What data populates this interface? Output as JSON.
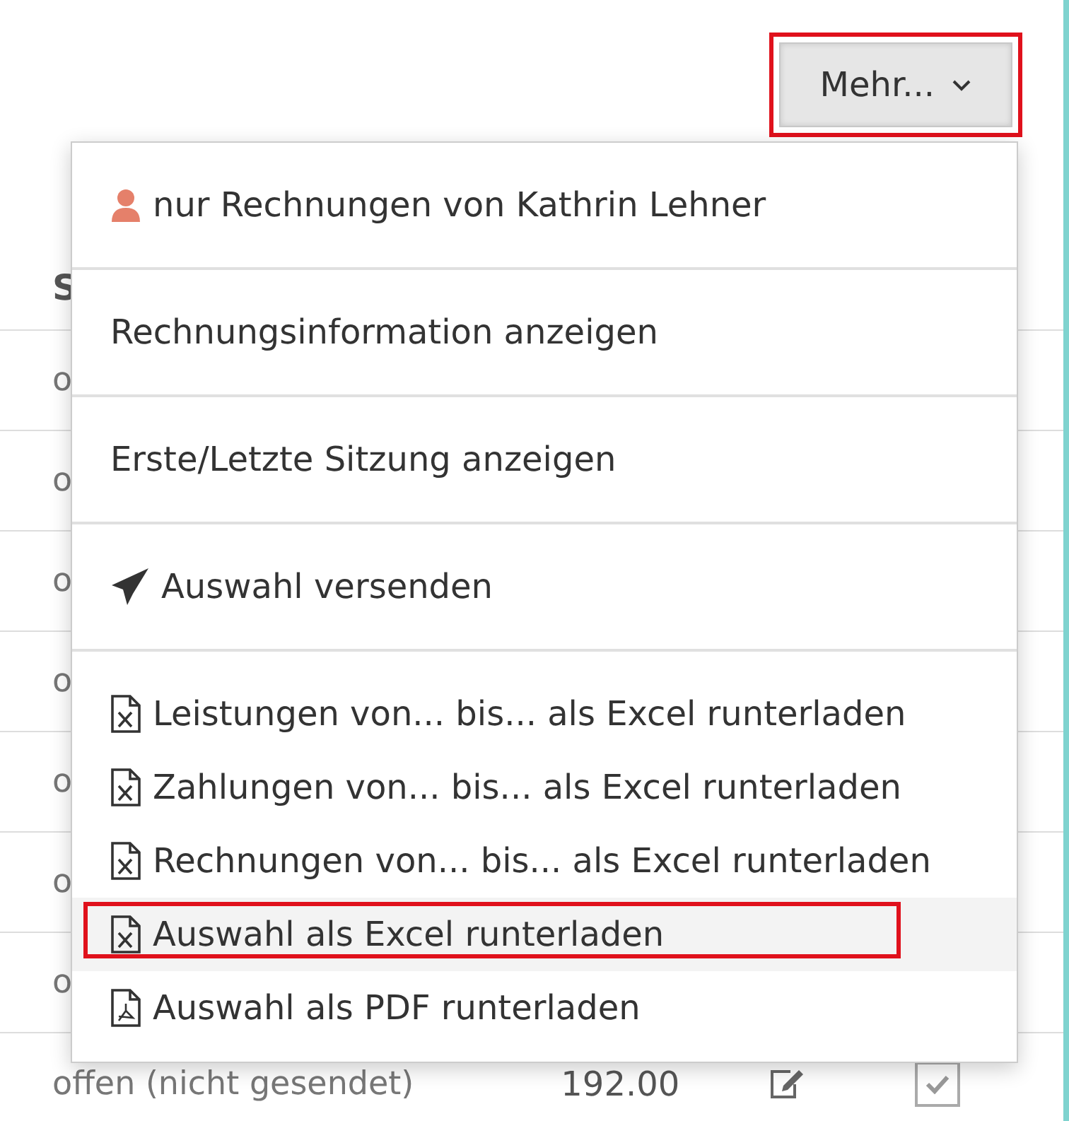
{
  "toolbar": {
    "button": {
      "label": "Mehr...",
      "highlighted": true
    }
  },
  "table": {
    "header": "S",
    "rows": [
      {
        "status": "o"
      },
      {
        "status": "o"
      },
      {
        "status": "o"
      },
      {
        "status": "o"
      },
      {
        "status": "o"
      },
      {
        "status": "o"
      },
      {
        "status": "o"
      },
      {
        "status": "offen (nicht gesendet)",
        "amount": "192.00",
        "checked": true
      }
    ]
  },
  "menu": {
    "sections": [
      {
        "items": [
          {
            "label": "nur Rechnungen von Kathrin Lehner",
            "kind": "user",
            "selected": false,
            "highlighted": false
          }
        ]
      },
      {
        "items": [
          {
            "label": "Rechnungsinformation anzeigen",
            "selected": false,
            "highlighted": false
          }
        ]
      },
      {
        "items": [
          {
            "label": "Erste/Letzte Sitzung anzeigen",
            "selected": false,
            "highlighted": false
          }
        ]
      },
      {
        "items": [
          {
            "label": "Auswahl versenden",
            "kind": "send",
            "selected": false,
            "highlighted": false
          }
        ]
      },
      {
        "items": [
          {
            "label": "Leistungen von... bis... als Excel runterladen",
            "kind": "excel",
            "selected": false,
            "highlighted": false
          },
          {
            "label": "Zahlungen von... bis... als Excel runterladen",
            "kind": "excel",
            "selected": false,
            "highlighted": false
          },
          {
            "label": "Rechnungen von... bis... als Excel runterladen",
            "kind": "excel",
            "selected": false,
            "highlighted": false
          },
          {
            "label": "Auswahl als Excel runterladen",
            "kind": "excel",
            "selected": true,
            "highlighted": true
          },
          {
            "label": "Auswahl als PDF runterladen",
            "kind": "pdf",
            "selected": false,
            "highlighted": false
          }
        ]
      }
    ]
  }
}
